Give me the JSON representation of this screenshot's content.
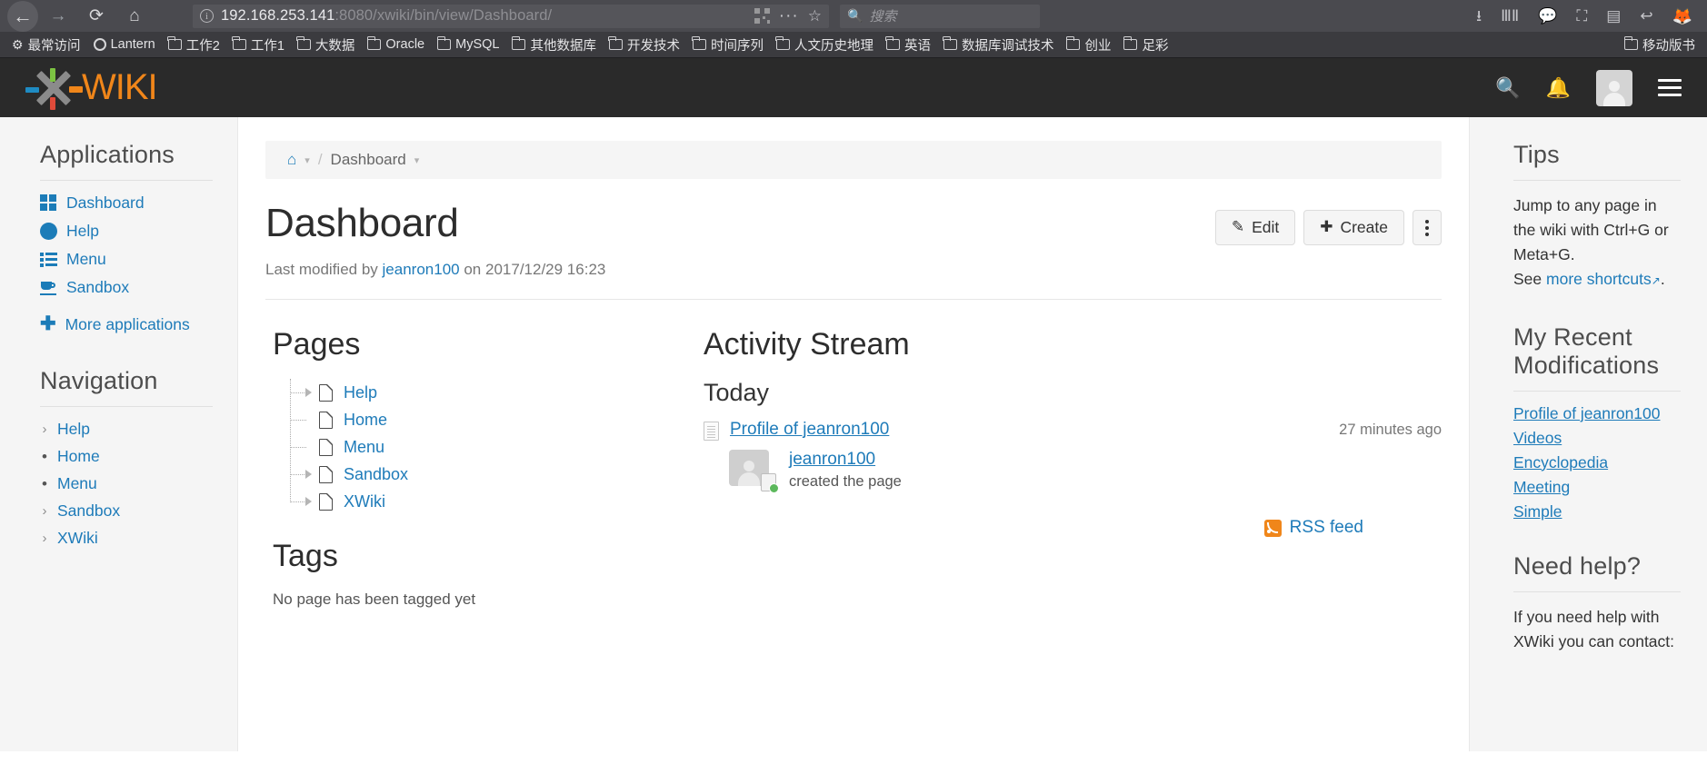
{
  "browser": {
    "url_host": "192.168.253.141",
    "url_rest": ":8080/xwiki/bin/view/Dashboard/",
    "search_placeholder": "搜索",
    "nav": {
      "back": "←",
      "forward": "→",
      "reload": "⟳",
      "home": "⌂"
    },
    "toolbar_icons": [
      "download-icon",
      "library-icon",
      "pocket-icon",
      "screenshot-icon",
      "sidebar-icon",
      "undo-icon",
      "firefox-account-icon"
    ],
    "bookmarks": [
      {
        "label": "最常访问",
        "icon": "gear-icon"
      },
      {
        "label": "Lantern",
        "icon": "circle-icon"
      },
      {
        "label": "工作2",
        "icon": "folder-icon"
      },
      {
        "label": "工作1",
        "icon": "folder-icon"
      },
      {
        "label": "大数据",
        "icon": "folder-icon"
      },
      {
        "label": "Oracle",
        "icon": "folder-icon"
      },
      {
        "label": "MySQL",
        "icon": "folder-icon"
      },
      {
        "label": "其他数据库",
        "icon": "folder-icon"
      },
      {
        "label": "开发技术",
        "icon": "folder-icon"
      },
      {
        "label": "时间序列",
        "icon": "folder-icon"
      },
      {
        "label": "人文历史地理",
        "icon": "folder-icon"
      },
      {
        "label": "英语",
        "icon": "folder-icon"
      },
      {
        "label": "数据库调试技术",
        "icon": "folder-icon"
      },
      {
        "label": "创业",
        "icon": "folder-icon"
      },
      {
        "label": "足彩",
        "icon": "folder-icon"
      }
    ],
    "bookmarks_overflow": "移动版书"
  },
  "header": {
    "logo_text": "WIKI",
    "icons": [
      "search-icon",
      "notifications-bell-icon",
      "user-avatar",
      "main-menu-icon"
    ]
  },
  "sidebar": {
    "applications_title": "Applications",
    "apps": [
      {
        "label": "Dashboard",
        "icon": "dashboard-icon"
      },
      {
        "label": "Help",
        "icon": "help-circle-icon"
      },
      {
        "label": "Menu",
        "icon": "list-icon"
      },
      {
        "label": "Sandbox",
        "icon": "coffee-cup-icon"
      }
    ],
    "more_applications": "More applications",
    "navigation_title": "Navigation",
    "nav_items": [
      {
        "label": "Help",
        "marker": "chevron"
      },
      {
        "label": "Home",
        "marker": "bullet"
      },
      {
        "label": "Menu",
        "marker": "bullet"
      },
      {
        "label": "Sandbox",
        "marker": "chevron"
      },
      {
        "label": "XWiki",
        "marker": "chevron"
      }
    ]
  },
  "main": {
    "breadcrumb": {
      "home_icon": "home-icon",
      "separator": "/",
      "current": "Dashboard"
    },
    "title": "Dashboard",
    "buttons": {
      "edit": "Edit",
      "create": "Create",
      "more": "more-actions"
    },
    "last_modified": {
      "prefix": "Last modified by",
      "user": "jeanron100",
      "middle": "on",
      "date": "2017/12/29 16:23"
    },
    "pages": {
      "title": "Pages",
      "items": [
        {
          "label": "Help",
          "expandable": true
        },
        {
          "label": "Home",
          "expandable": false
        },
        {
          "label": "Menu",
          "expandable": false
        },
        {
          "label": "Sandbox",
          "expandable": true
        },
        {
          "label": "XWiki",
          "expandable": true
        }
      ]
    },
    "tags": {
      "title": "Tags",
      "empty_text": "No page has been tagged yet"
    },
    "activity": {
      "title": "Activity Stream",
      "today_label": "Today",
      "entry_title": "Profile of jeanron100",
      "entry_time": "27 minutes ago",
      "entry_user": "jeanron100",
      "entry_action": "created the page",
      "rss_label": "RSS feed"
    }
  },
  "right": {
    "tips_title": "Tips",
    "tips_body": "Jump to any page in the wiki with Ctrl+G or Meta+G.",
    "tips_see": "See",
    "tips_link": "more shortcuts",
    "tips_period": ".",
    "recent_title": "My Recent Modifications",
    "recent_links": [
      "Profile of jeanron100",
      "Videos",
      "Encyclopedia",
      "Meeting",
      "Simple"
    ],
    "help_title": "Need help?",
    "help_body": "If you need help with XWiki you can contact:"
  },
  "colors": {
    "brand_orange": "#f0861a",
    "link_blue": "#1e7bb9",
    "header_dark": "#2a2a2a",
    "panel_gray": "#f5f5f5"
  }
}
